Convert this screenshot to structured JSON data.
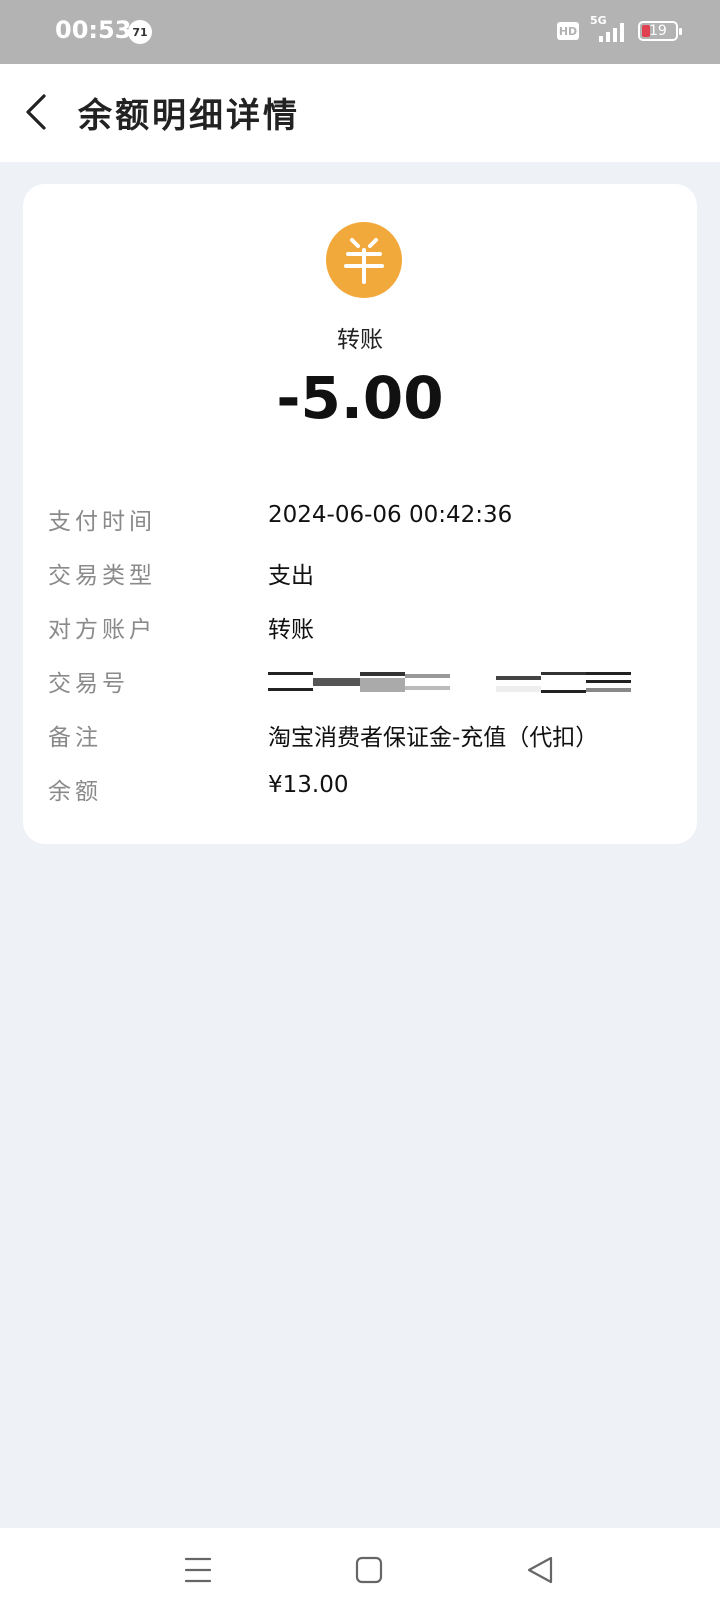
{
  "status_bar": {
    "time": "00:53",
    "notification_count": "71",
    "hd_label": "HD",
    "network": "5G",
    "battery": "19",
    "battery_color": "#e0404f"
  },
  "header": {
    "title": "余额明细详情",
    "back_icon": "chevron-left-icon"
  },
  "summary": {
    "icon": "yuan-icon",
    "icon_color": "#f2a93b",
    "type": "转账",
    "amount": "-5.00"
  },
  "details": [
    {
      "label": "支付时间",
      "value": "2024-06-06 00:42:36"
    },
    {
      "label": "交易类型",
      "value": "支出"
    },
    {
      "label": "对方账户",
      "value": "转账"
    },
    {
      "label": "交易号",
      "value": ""
    },
    {
      "label": "备注",
      "value": "淘宝消费者保证金-充值（代扣）"
    },
    {
      "label": "余额",
      "value": "¥13.00"
    }
  ],
  "nav_bar": {
    "menu_icon": "menu-icon",
    "home_icon": "home-square-icon",
    "back_icon": "back-triangle-icon"
  }
}
